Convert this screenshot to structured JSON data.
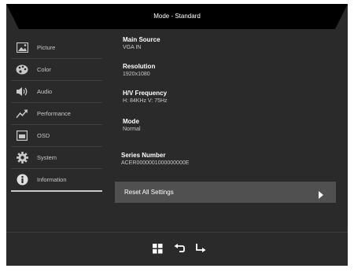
{
  "header": {
    "title": "Mode - Standard"
  },
  "sidebar": {
    "items": [
      {
        "label": "Picture",
        "icon": "picture-icon"
      },
      {
        "label": "Color",
        "icon": "palette-icon"
      },
      {
        "label": "Audio",
        "icon": "speaker-icon"
      },
      {
        "label": "Performance",
        "icon": "performance-icon"
      },
      {
        "label": "OSD",
        "icon": "osd-icon"
      },
      {
        "label": "System",
        "icon": "gear-icon"
      },
      {
        "label": "Information",
        "icon": "info-icon"
      }
    ],
    "active": "Information"
  },
  "info": {
    "main_source": {
      "label": "Main Source",
      "value": "VGA IN"
    },
    "resolution": {
      "label": "Resolution",
      "value": "1920x1080"
    },
    "frequency": {
      "label": "H/V Frequency",
      "value": "H: 84KHz V: 75Hz"
    },
    "mode": {
      "label": "Mode",
      "value": "Normal"
    },
    "series": {
      "label": "Series Number",
      "value": "ACER0000001000000000E"
    }
  },
  "reset": {
    "label": "Reset All Settings",
    "icon": "chevron-right-icon"
  },
  "footer": {
    "icons": [
      "menu-grid-icon",
      "back-icon",
      "enter-icon"
    ]
  },
  "colors": {
    "panel": "#2a2a2a",
    "header": "#000000",
    "highlight": "#505050"
  }
}
